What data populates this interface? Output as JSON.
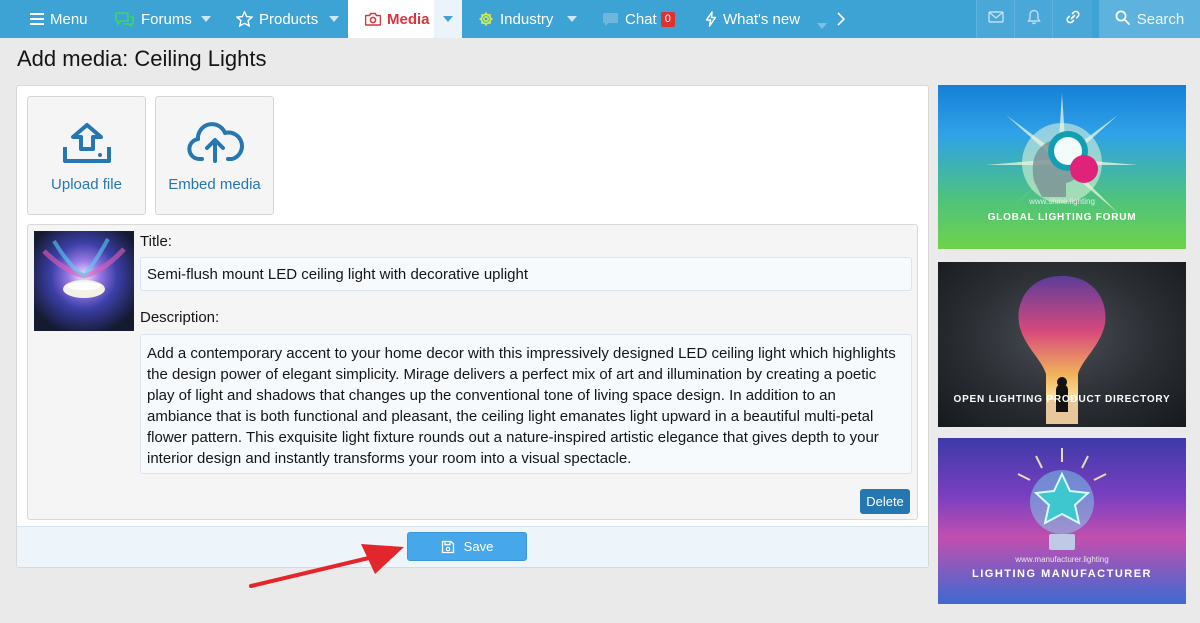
{
  "nav": {
    "menu": "Menu",
    "items": [
      {
        "label": "Forums"
      },
      {
        "label": "Products"
      },
      {
        "label": "Media"
      },
      {
        "label": "Industry"
      },
      {
        "label": "Chat",
        "badge": "0"
      },
      {
        "label": "What's new"
      }
    ],
    "search": "Search"
  },
  "page": {
    "title": "Add media: Ceiling Lights"
  },
  "uploads": {
    "upload_file": "Upload file",
    "embed_media": "Embed media"
  },
  "attachment": {
    "title_label": "Title:",
    "title_value": "Semi-flush mount LED ceiling light with decorative uplight",
    "description_label": "Description:",
    "description_value": "Add a contemporary accent to your home decor with this impressively designed LED ceiling light which highlights the design power of elegant simplicity. Mirage delivers a perfect mix of art and illumination by creating a poetic play of light and shadows that changes up the conventional tone of living space design. In addition to an ambiance that is both functional and pleasant, the ceiling light emanates light upward in a beautiful multi-petal flower pattern. This exquisite light fixture rounds out a nature-inspired artistic elegance that gives depth to your interior design and instantly transforms your room into a visual spectacle.",
    "delete_label": "Delete"
  },
  "form": {
    "save_label": "Save"
  },
  "sidebar": {
    "ads": [
      {
        "caption": "GLOBAL LIGHTING FORUM",
        "url": "www.shine.lighting"
      },
      {
        "caption": "OPEN LIGHTING PRODUCT DIRECTORY"
      },
      {
        "caption": "LIGHTING MANUFACTURER",
        "url": "www.manufacturer.lighting"
      }
    ]
  },
  "colors": {
    "nav_bg": "#3da2d4",
    "active_tab_text": "#d9353b",
    "link": "#2577b1",
    "save_button": "#47a7eb",
    "arrow": "#e3262b"
  }
}
